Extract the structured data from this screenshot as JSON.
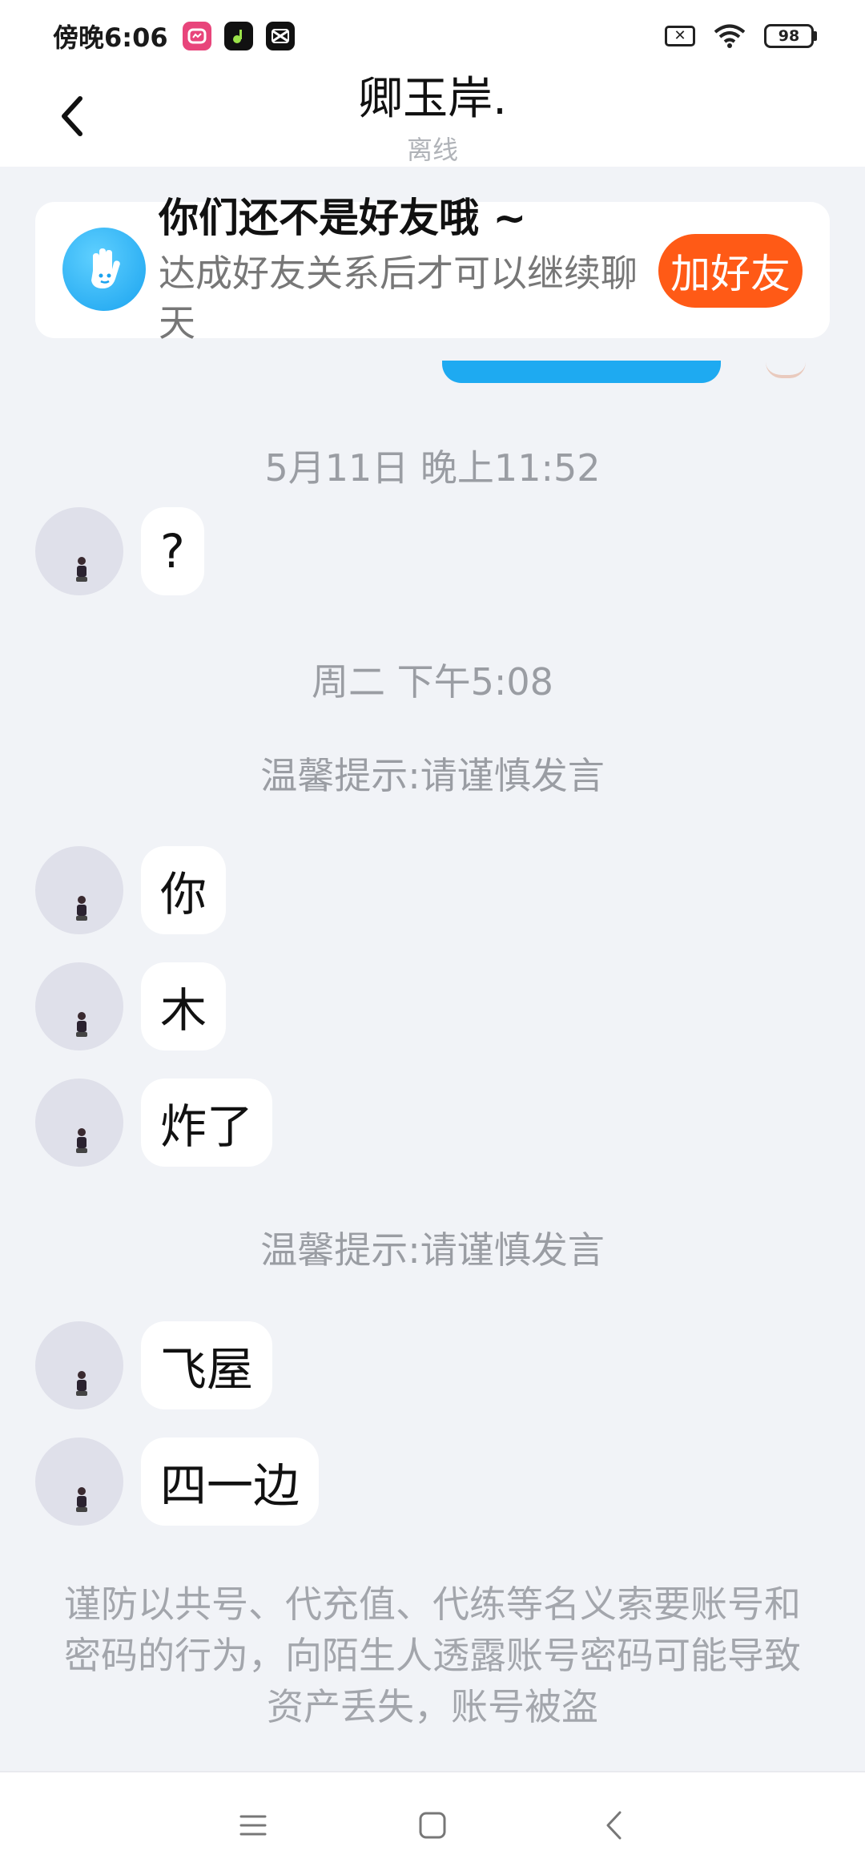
{
  "status_bar": {
    "time": "傍晚6:06",
    "battery": "98",
    "app_icons": [
      "pink-app-icon",
      "music-app-icon",
      "capcut-app-icon"
    ]
  },
  "header": {
    "title": "卿玉岸.",
    "status": "离线"
  },
  "friend_banner": {
    "title": "你们还不是好友哦 ~",
    "description": "达成好友关系后才可以继续聊天",
    "add_button": "加好友",
    "button_color": "#ff5a16"
  },
  "chat": {
    "timestamp_1": "5月11日 晚上11:52",
    "timestamp_2": "周二 下午5:08",
    "tip_1": "温馨提示:请谨慎发言",
    "tip_2": "温馨提示:请谨慎发言",
    "messages": [
      {
        "text": "?"
      },
      {
        "text": "你"
      },
      {
        "text": "木"
      },
      {
        "text": "炸了"
      },
      {
        "text": "飞屋"
      },
      {
        "text": "四一边"
      }
    ],
    "warning": "谨防以共号、代充值、代练等名义索要账号和密码的行为，向陌生人透露账号密码可能导致资产丢失，账号被盗"
  },
  "colors": {
    "background": "#f1f3f7",
    "accent_blue": "#1eaaf1"
  }
}
